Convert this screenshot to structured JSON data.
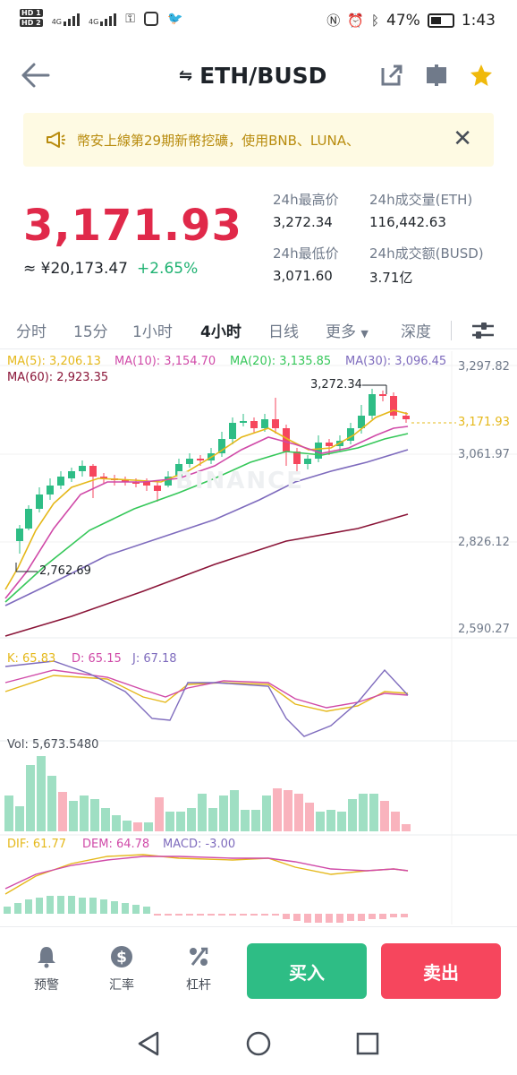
{
  "status": {
    "sim1": "HD 1",
    "sim2": "HD 2",
    "net1": "4G",
    "net2": "4G",
    "battery": "47%",
    "time": "1:43"
  },
  "header": {
    "pair": "ETH/BUSD",
    "swap_glyph": "⇋"
  },
  "banner": {
    "text": "幣安上線第29期新幣挖礦，使用BNB、LUNA、"
  },
  "ticker": {
    "last_price": "3,171.93",
    "fiat": "≈ ¥20,173.47",
    "change": "+2.65%",
    "high_label": "24h最高价",
    "high": "3,272.34",
    "low_label": "24h最低价",
    "low": "3,071.60",
    "vol_label": "24h成交量(ETH)",
    "vol": "116,442.63",
    "amt_label": "24h成交额(BUSD)",
    "amt": "3.71亿"
  },
  "tabs": [
    "分时",
    "15分",
    "1小时",
    "4小时",
    "日线",
    "更多",
    "深度"
  ],
  "active_tab": "4小时",
  "ma_labels": {
    "ma5": "MA(5): 3,206.13",
    "ma10": "MA(10): 3,154.70",
    "ma20": "MA(20): 3,135.85",
    "ma30": "MA(30): 3,096.45",
    "ma60": "MA(60): 2,923.35"
  },
  "price_axis": [
    "3,297.82",
    "3,061.97",
    "2,826.12",
    "2,590.27"
  ],
  "current_price_tag": "3,171.93",
  "high_marker": "3,272.34",
  "low_marker": "2,762.69",
  "watermark": "BINANCE",
  "kdj": {
    "k": "K: 65.83",
    "d": "D: 65.15",
    "j": "J: 67.18"
  },
  "volume_label": "Vol: 5,673.5480",
  "macd": {
    "dif": "DIF: 61.77",
    "dem": "DEM: 64.78",
    "macd": "MACD: -3.00"
  },
  "bottom": {
    "alert": "预警",
    "rate": "汇率",
    "leverage": "杠杆",
    "buy": "买入",
    "sell": "卖出"
  },
  "colors": {
    "up": "#2ebd85",
    "down": "#f6465d",
    "ma5": "#e5b81a",
    "ma10": "#d04aa8",
    "ma20": "#35c759",
    "ma30": "#7e6bbd",
    "ma60": "#8a1538"
  }
}
